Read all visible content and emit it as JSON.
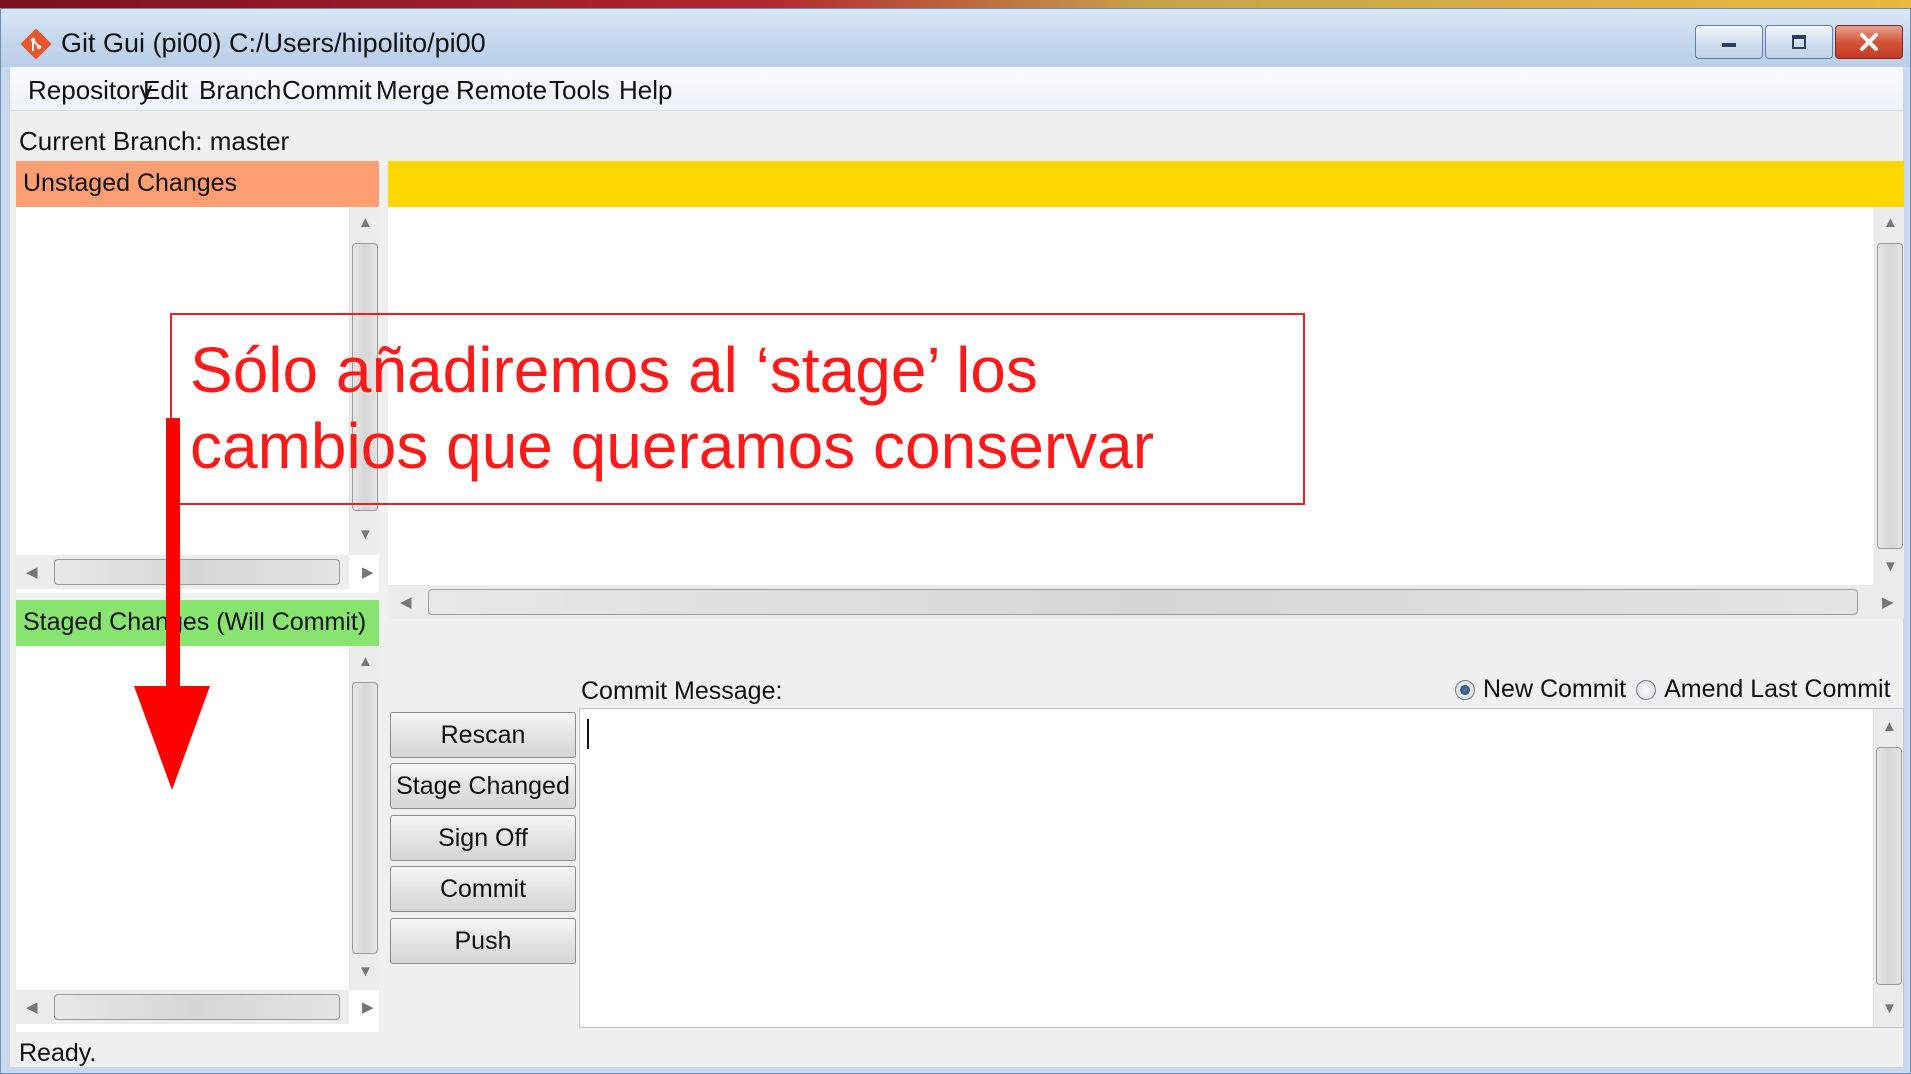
{
  "window": {
    "title": "Git Gui (pi00) C:/Users/hipolito/pi00",
    "icon": "git-diamond-icon",
    "controls": [
      "minimize-icon",
      "maximize-icon",
      "close-icon"
    ]
  },
  "menu": {
    "items": [
      "Repository",
      "Edit",
      "Branch",
      "Commit",
      "Merge",
      "Remote",
      "Tools",
      "Help"
    ]
  },
  "branch": {
    "label": "Current Branch: master"
  },
  "unstaged": {
    "header": "Unstaged Changes",
    "color": "#ff9e73"
  },
  "staged": {
    "header": "Staged Changes (Will Commit)",
    "color": "#86e46f"
  },
  "diff": {
    "header_color": "#ffd700"
  },
  "commit": {
    "label": "Commit Message:",
    "new_commit": "New Commit",
    "amend_last_commit": "Amend Last Commit",
    "selected": "New Commit",
    "message": ""
  },
  "buttons": {
    "rescan": "Rescan",
    "stage_changed": "Stage Changed",
    "sign_off": "Sign Off",
    "commit": "Commit",
    "push": "Push"
  },
  "status": {
    "text": "Ready."
  },
  "annotation": {
    "line1": "Sólo añadiremos al ‘stage’ los",
    "line2": "cambios que queramos conservar",
    "color": "#ff1a1a"
  }
}
